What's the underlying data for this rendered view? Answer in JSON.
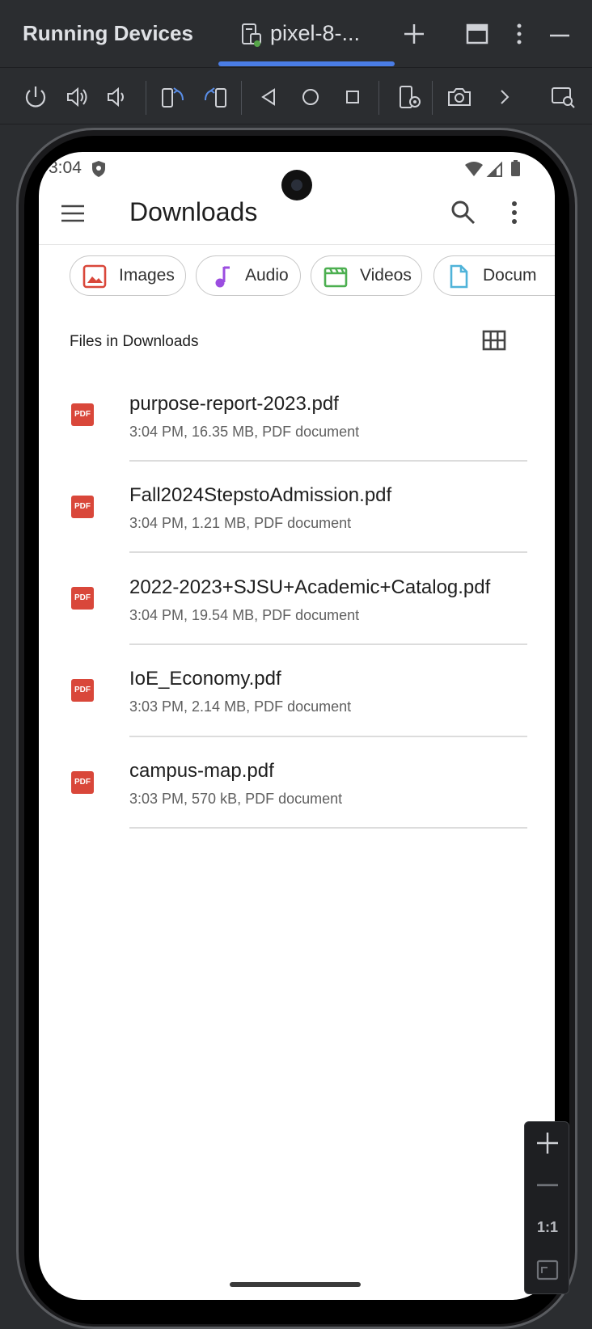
{
  "panel": {
    "title": "Running Devices",
    "tab_label": "pixel-8-..."
  },
  "toolbar": {
    "items": [
      "power-icon",
      "volume-up-icon",
      "volume-down-icon",
      "rotate-left-icon",
      "rotate-right-icon",
      "back-icon",
      "home-icon",
      "overview-icon",
      "device-settings-icon",
      "camera-icon",
      "chevron-right-icon",
      "screen-search-icon"
    ]
  },
  "status_bar": {
    "time": "3:04"
  },
  "app_bar": {
    "title": "Downloads"
  },
  "chips": [
    {
      "label": "Images",
      "icon": "image-icon",
      "color": "#d9473a"
    },
    {
      "label": "Audio",
      "icon": "music-note-icon",
      "color": "#9b4de0"
    },
    {
      "label": "Videos",
      "icon": "movie-icon",
      "color": "#4caf50"
    },
    {
      "label": "Docum",
      "icon": "document-icon",
      "color": "#4fb3d9"
    }
  ],
  "section": {
    "label": "Files in Downloads"
  },
  "files": [
    {
      "name": "purpose-report-2023.pdf",
      "meta": "3:04 PM, 16.35 MB, PDF document",
      "icon_text": "PDF"
    },
    {
      "name": "Fall2024StepstoAdmission.pdf",
      "meta": "3:04 PM, 1.21 MB, PDF document",
      "icon_text": "PDF"
    },
    {
      "name": "2022-2023+SJSU+Academic+Catalog.pdf",
      "meta": "3:04 PM, 19.54 MB, PDF document",
      "icon_text": "PDF"
    },
    {
      "name": "IoE_Economy.pdf",
      "meta": "3:03 PM, 2.14 MB, PDF document",
      "icon_text": "PDF"
    },
    {
      "name": "campus-map.pdf",
      "meta": "3:03 PM, 570 kB, PDF document",
      "icon_text": "PDF"
    }
  ],
  "zoom": {
    "ratio_label": "1:1"
  },
  "colors": {
    "accent": "#4a7de6",
    "pdf": "#d9473a"
  }
}
